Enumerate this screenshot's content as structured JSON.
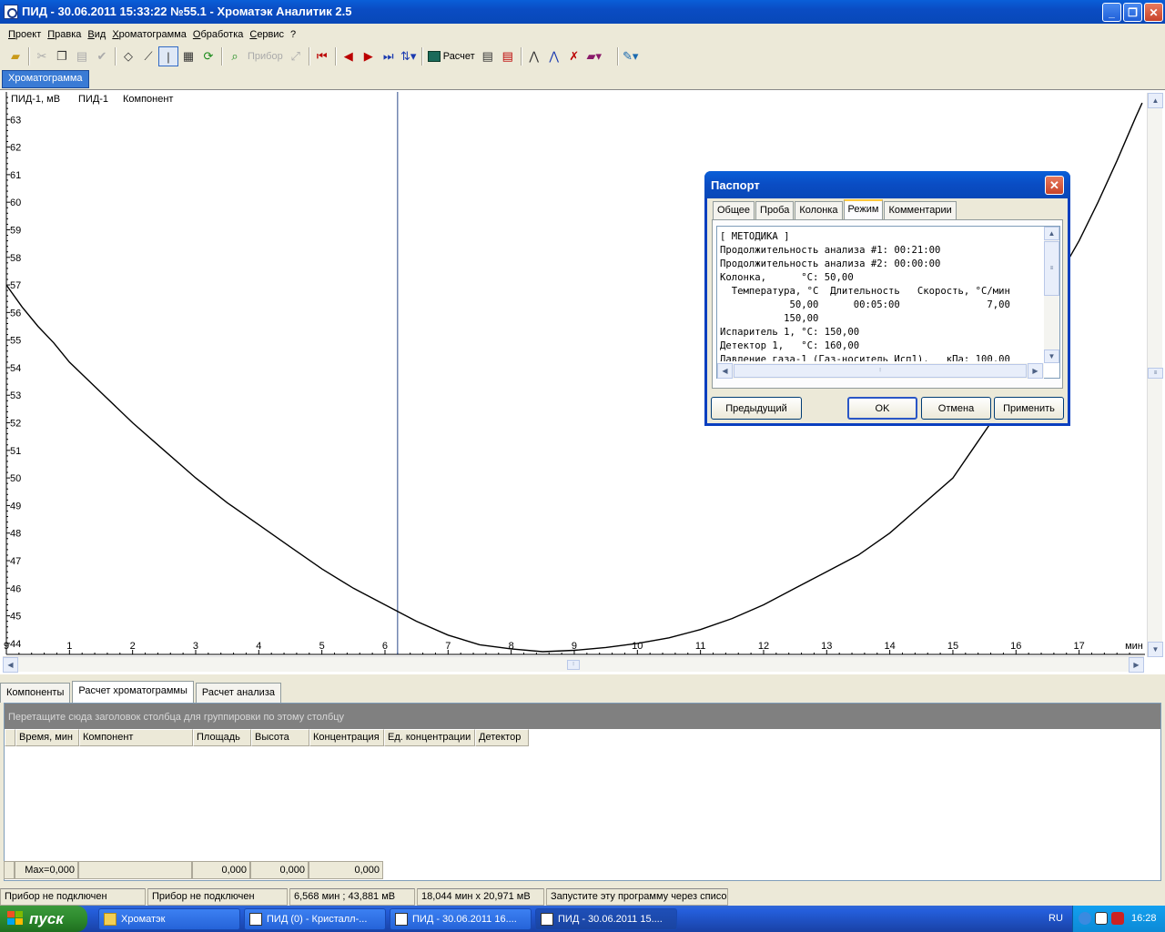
{
  "window": {
    "title": "ПИД - 30.06.2011 15:33:22 №55.1 - Хроматэк Аналитик 2.5"
  },
  "menu": [
    "Проект",
    "Правка",
    "Вид",
    "Хроматограмма",
    "Обработка",
    "Сервис",
    "?"
  ],
  "toolbar": {
    "instrument_label": "Прибор",
    "calc_label": "Расчет"
  },
  "chart_tab": "Хроматограмма",
  "chart_data": {
    "type": "line",
    "header_labels": [
      "ПИД-1, мВ",
      "ПИД-1",
      "Компонент"
    ],
    "x_unit": "мин",
    "x_ticks": [
      "9",
      "1",
      "2",
      "3",
      "4",
      "5",
      "6",
      "7",
      "8",
      "9",
      "10",
      "11",
      "12",
      "13",
      "14",
      "15",
      "16",
      "17"
    ],
    "y_ticks": [
      44,
      45,
      46,
      47,
      48,
      49,
      50,
      51,
      52,
      53,
      54,
      55,
      56,
      57,
      58,
      59,
      60,
      61,
      62,
      63
    ],
    "xlim": [
      0,
      18.044
    ],
    "ylim": [
      43.6,
      64.0
    ],
    "cursor_x": 6.2,
    "series": [
      {
        "x": [
          0,
          0.25,
          0.5,
          0.75,
          1,
          1.5,
          2,
          2.5,
          3,
          3.5,
          4,
          4.5,
          5,
          5.5,
          6,
          6.5,
          7,
          7.5,
          8,
          8.5,
          9,
          9.5,
          10,
          10.5,
          11,
          11.5,
          12,
          12.5,
          13,
          13.5,
          14,
          14.5,
          15,
          15.3,
          15.6,
          16,
          16.3,
          16.6,
          17,
          17.3,
          17.6,
          17.9,
          18.0
        ],
        "y": [
          57.0,
          56.2,
          55.5,
          54.9,
          54.2,
          53.1,
          52.0,
          51.0,
          50.0,
          49.1,
          48.3,
          47.5,
          46.7,
          46.0,
          45.4,
          44.8,
          44.3,
          43.95,
          43.8,
          43.7,
          43.75,
          43.85,
          44.0,
          44.2,
          44.5,
          44.9,
          45.4,
          46.0,
          46.6,
          47.2,
          48.0,
          49.0,
          50.0,
          51.0,
          52.0,
          54.0,
          55.5,
          57.0,
          58.6,
          60.0,
          61.5,
          63.1,
          63.6
        ]
      }
    ]
  },
  "dialog": {
    "title": "Паспорт",
    "tabs": [
      "Общее",
      "Проба",
      "Колонка",
      "Режим",
      "Комментарии"
    ],
    "active_tab": "Режим",
    "text": "[ МЕТОДИКА ]\nПродолжительность анализа #1: 00:21:00\nПродолжительность анализа #2: 00:00:00\nКолонка,      °C: 50,00\n  Температура, °C  Длительность   Скорость, °С/мин\n            50,00      00:05:00               7,00\n           150,00\nИспаритель 1, °C: 150,00\nДетектор 1,   °C: 160,00\nДавление газа-1 (Газ-носитель Исп1),   кПа: 100,00",
    "buttons": {
      "prev": "Предыдущий",
      "ok": "OK",
      "cancel": "Отмена",
      "apply": "Применить"
    }
  },
  "bottom_tabs": [
    "Компоненты",
    "Расчет хроматограммы",
    "Расчет анализа"
  ],
  "grid": {
    "group_hint": "Перетащите сюда заголовок столбца для группировки по этому столбцу",
    "columns": [
      "Время, мин",
      "Компонент",
      "Площадь",
      "Высота",
      "Концентрация",
      "Ед. концентрации",
      "Детектор"
    ],
    "footer": {
      "max": "Max=0,000",
      "area": "0,000",
      "height": "0,000",
      "conc": "0,000"
    }
  },
  "statusbar": [
    "Прибор не подключен",
    "Прибор не подключен",
    "6,568 мин ; 43,881 мВ",
    "18,044 мин x 20,971 мВ",
    "Запустите эту программу через списо"
  ],
  "taskbar": {
    "start": "пуск",
    "tasks": [
      "Хроматэк",
      "ПИД (0) - Кристалл-...",
      "ПИД - 30.06.2011 16....",
      "ПИД - 30.06.2011 15...."
    ],
    "lang": "RU",
    "clock": "16:28"
  }
}
